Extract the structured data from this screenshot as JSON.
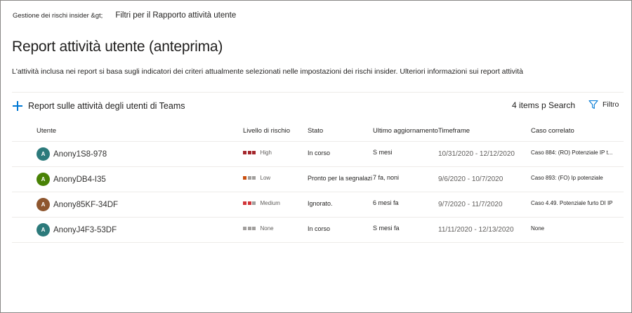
{
  "breadcrumb": {
    "root": "Gestione dei rischi insider &gt;",
    "current": "Filtri per il Rapporto attività utente"
  },
  "page": {
    "title": "Report attività utente (anteprima)",
    "description": "L'attività inclusa nei report si basa sugli indicatori dei criteri attualmente selezionati nelle impostazioni dei rischi insider. Ulteriori informazioni sui report attività"
  },
  "toolbar": {
    "add_label": "Report sulle attività degli utenti di Teams",
    "items_info": "4 items p Search",
    "filter_label": "Filtro",
    "add_icon": "plus-icon",
    "filter_icon": "funnel-icon"
  },
  "table": {
    "headers": {
      "user": "Utente",
      "risk": "Livello di rischio",
      "status": "Stato",
      "updated": "Ultimo aggiornamento",
      "timeframe": "Timeframe",
      "case": "Caso correlato"
    },
    "rows": [
      {
        "avatar": "A",
        "avatar_color": "#2c7a7b",
        "user": "Anony1S8-978",
        "risk": "High",
        "risk_colors": [
          "#a4262c",
          "#a4262c",
          "#a4262c"
        ],
        "status": "In corso",
        "updated": "S mesi",
        "timeframe": "10/31/2020 - 12/12/2020",
        "case": "Caso 884: (RO) Potenziale IP t..."
      },
      {
        "avatar": "A",
        "avatar_color": "#498205",
        "user": "AnonyDB4-I35",
        "risk": "Low",
        "risk_colors": [
          "#ca5010",
          "#a19f9d",
          "#a19f9d"
        ],
        "status": "Pronto per la segnalazione",
        "updated": "7 fa, noni",
        "timeframe": "9/6/2020 - 10/7/2020",
        "case": "Caso 893: (FO) Ip potenziale"
      },
      {
        "avatar": "A",
        "avatar_color": "#8e562e",
        "user": "Anony85KF-34DF",
        "risk": "Medium",
        "risk_colors": [
          "#d13438",
          "#d13438",
          "#a19f9d"
        ],
        "status": "Ignorato.",
        "updated": "6 mesi fa",
        "timeframe": "9/7/2020 - 11/7/2020",
        "case": "Caso 4.49. Potenziale furto DI IP"
      },
      {
        "avatar": "A",
        "avatar_color": "#2c7a7b",
        "user": "AnonyJ4F3-53DF",
        "risk": "None",
        "risk_colors": [
          "#a19f9d",
          "#a19f9d",
          "#a19f9d"
        ],
        "status": "In corso",
        "updated": "S mesi fa",
        "timeframe": "11/11/2020 - 12/13/2020",
        "case": "None"
      }
    ]
  }
}
